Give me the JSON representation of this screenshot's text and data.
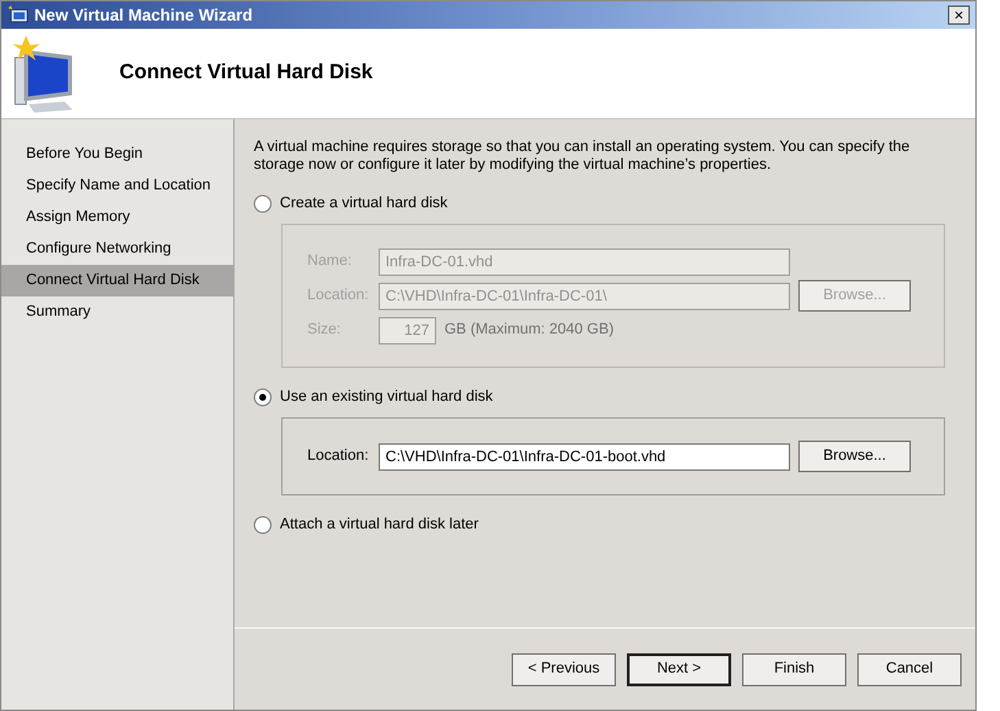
{
  "window": {
    "title": "New Virtual Machine Wizard",
    "close": "×"
  },
  "header": {
    "title": "Connect Virtual Hard Disk"
  },
  "steps": [
    {
      "label": "Before You Begin",
      "selected": false
    },
    {
      "label": "Specify Name and Location",
      "selected": false
    },
    {
      "label": "Assign Memory",
      "selected": false
    },
    {
      "label": "Configure Networking",
      "selected": false
    },
    {
      "label": "Connect Virtual Hard Disk",
      "selected": true
    },
    {
      "label": "Summary",
      "selected": false
    }
  ],
  "description": "A virtual machine requires storage so that you can install an operating system. You can specify the storage now or configure it later by modifying the virtual machine’s properties.",
  "options": [
    {
      "kind": "create",
      "label": "Create a virtual hard disk",
      "selected": false,
      "disabled": true,
      "fields": [
        {
          "kind": "text",
          "label": "Name:",
          "value": "Infra-DC-01.vhd"
        },
        {
          "kind": "browse",
          "label": "Location:",
          "value": "C:\\VHD\\Infra-DC-01\\Infra-DC-01\\",
          "button": "Browse..."
        },
        {
          "kind": "size",
          "label": "Size:",
          "value": "127",
          "suffix": "GB (Maximum: 2040 GB)"
        }
      ]
    },
    {
      "kind": "existing",
      "label": "Use an existing virtual hard disk",
      "selected": true,
      "disabled": false,
      "fields": [
        {
          "kind": "browse",
          "label": "Location:",
          "value": "C:\\VHD\\Infra-DC-01\\Infra-DC-01-boot.vhd",
          "button": "Browse..."
        }
      ]
    },
    {
      "kind": "later",
      "label": "Attach a virtual hard disk later",
      "selected": false
    }
  ],
  "buttons": [
    {
      "label": "< Previous",
      "default": false
    },
    {
      "label": "Next >",
      "default": true
    },
    {
      "label": "Finish",
      "default": false
    },
    {
      "label": "Cancel",
      "default": false
    }
  ]
}
